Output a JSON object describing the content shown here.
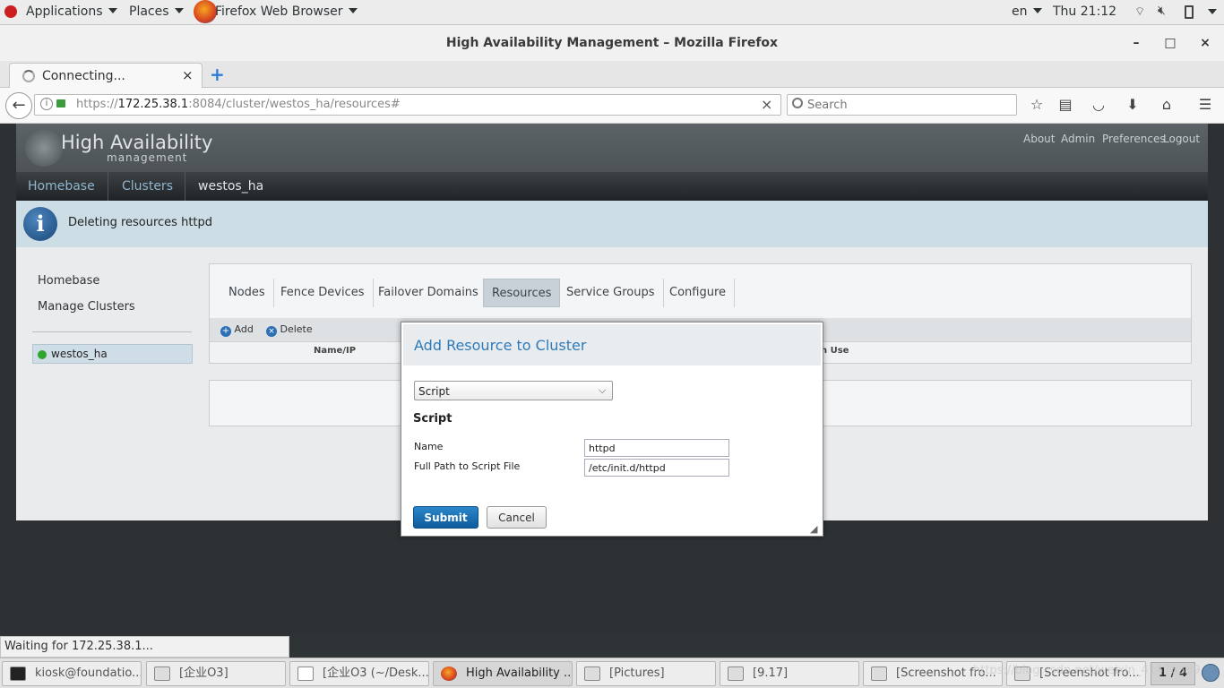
{
  "topbar": {
    "applications": "Applications",
    "places": "Places",
    "browser": "Firefox Web Browser",
    "lang": "en",
    "clock": "Thu 21:12"
  },
  "window": {
    "title": "High Availability Management – Mozilla Firefox",
    "min": "–",
    "max": "□",
    "close": "×"
  },
  "tab": {
    "label": "Connecting...",
    "close": "×",
    "new_tab": "+"
  },
  "nav": {
    "url_prefix": "https://",
    "url_host": "172.25.38.1",
    "url_rest": ":8084/cluster/westos_ha/resources#",
    "clear": "×",
    "search_placeholder": "Search"
  },
  "app": {
    "logo_title": "High Availability",
    "logo_sub": "management",
    "header_links": [
      "About",
      "Admin",
      "Preferences",
      "Logout"
    ],
    "breadcrumb": [
      "Homebase",
      "Clusters",
      "westos_ha"
    ],
    "message": "Deleting resources httpd",
    "sidebar": {
      "homebase": "Homebase",
      "manage": "Manage Clusters",
      "cluster": "westos_ha"
    },
    "tabs": [
      "Nodes",
      "Fence Devices",
      "Failover Domains",
      "Resources",
      "Service Groups",
      "Configure"
    ],
    "active_tab": "Resources",
    "add_label": "Add",
    "delete_label": "Delete",
    "col_name": "Name/IP",
    "col_inuse": "n Use"
  },
  "modal": {
    "title": "Add Resource to Cluster",
    "select_value": "Script",
    "section": "Script",
    "name_label": "Name",
    "name_value": "httpd",
    "path_label": "Full Path to Script File",
    "path_value": "/etc/init.d/httpd",
    "submit": "Submit",
    "cancel": "Cancel"
  },
  "status": "Waiting for 172.25.38.1...",
  "taskbar": [
    "kiosk@foundatio...",
    "[企业O3]",
    "[企业O3 (~/Desk...",
    "High Availability ...",
    "[Pictures]",
    "[9.17]",
    "[Screenshot fro...",
    "[Screenshot fro..."
  ],
  "pager": "1 / 4",
  "watermark": "https://blog.csdn.net/weixin_41476369"
}
